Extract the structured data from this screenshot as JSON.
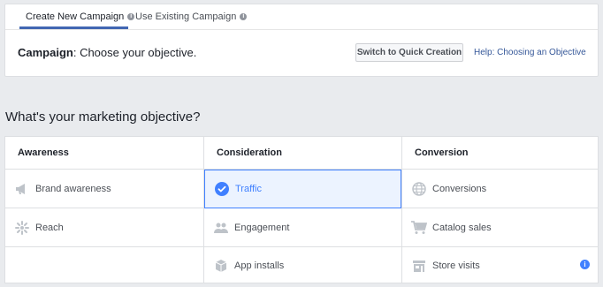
{
  "tabs": [
    {
      "label": "Create New Campaign",
      "active": true
    },
    {
      "label": "Use Existing Campaign",
      "active": false
    }
  ],
  "campaign": {
    "prefix": "Campaign",
    "text": ": Choose your objective.",
    "quick_button": "Switch to Quick Creation",
    "help_link": "Help: Choosing an Objective"
  },
  "question": "What's your marketing objective?",
  "columns": [
    {
      "header": "Awareness",
      "items": [
        {
          "label": "Brand awareness",
          "icon": "megaphone-icon"
        },
        {
          "label": "Reach",
          "icon": "reach-icon"
        },
        {
          "label": "",
          "icon": ""
        }
      ]
    },
    {
      "header": "Consideration",
      "items": [
        {
          "label": "Traffic",
          "icon": "checkmark-icon",
          "selected": true
        },
        {
          "label": "Engagement",
          "icon": "people-icon"
        },
        {
          "label": "App installs",
          "icon": "box-icon"
        }
      ]
    },
    {
      "header": "Conversion",
      "items": [
        {
          "label": "Conversions",
          "icon": "globe-icon"
        },
        {
          "label": "Catalog sales",
          "icon": "cart-icon"
        },
        {
          "label": "Store visits",
          "icon": "store-icon"
        }
      ]
    }
  ],
  "colors": {
    "accent": "#4080ff",
    "selected_bg": "#ecf3ff",
    "tab_underline": "#4267b2",
    "link": "#365899"
  }
}
